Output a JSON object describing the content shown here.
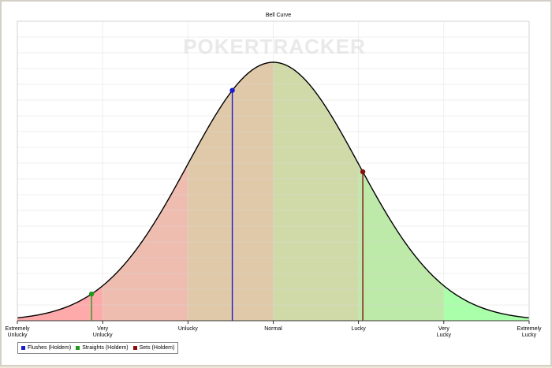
{
  "chart_data": {
    "type": "line",
    "title": "Bell Curve",
    "watermark": "POKERTRACKER",
    "curve": {
      "mean": 0,
      "sd": 1,
      "xlim": [
        -3,
        3
      ]
    },
    "categories": [
      "Extremely\nUnlucky",
      "Very\nUnlucky",
      "Unlucky",
      "Normal",
      "Lucky",
      "Very\nLucky",
      "Extremely\nLucky"
    ],
    "category_positions": [
      -3,
      -2,
      -1,
      0,
      1,
      2,
      3
    ],
    "bands": [
      {
        "from": -3,
        "to": -2,
        "color": "#ffaaaa"
      },
      {
        "from": -2,
        "to": -1,
        "color": "#efbdb0"
      },
      {
        "from": -1,
        "to": 0,
        "color": "#e0c9a8"
      },
      {
        "from": 0,
        "to": 1,
        "color": "#cfdaa8"
      },
      {
        "from": 1,
        "to": 2,
        "color": "#bdeaa8"
      },
      {
        "from": 2,
        "to": 3,
        "color": "#aaffaa"
      }
    ],
    "series": [
      {
        "name": "Flushes (Holdem)",
        "x": -0.48,
        "color": "#1b1bd0"
      },
      {
        "name": "Straights (Holdem)",
        "x": -2.13,
        "color": "#1f9a1f"
      },
      {
        "name": "Sets (Holdem)",
        "x": 1.05,
        "color": "#8b0e0e"
      }
    ],
    "grid": true,
    "legend_position": "bottom-left"
  }
}
